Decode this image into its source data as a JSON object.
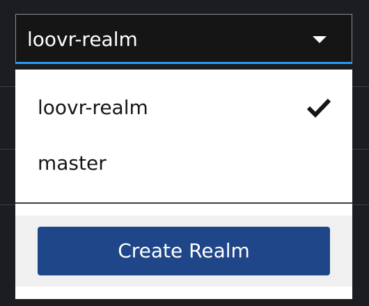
{
  "toggle": {
    "selected_label": "loovr-realm",
    "icon": "caret-down-icon"
  },
  "menu": {
    "items": [
      {
        "label": "loovr-realm",
        "selected": true,
        "icon": "check-icon"
      },
      {
        "label": "master",
        "selected": false
      }
    ],
    "create_button_label": "Create Realm"
  },
  "colors": {
    "background": "#1b1d21",
    "toggle_background": "#151515",
    "toggle_underline": "#2b9af3",
    "menu_background": "#ffffff",
    "footer_background": "#f0f0f0",
    "primary_button": "#1e4688"
  }
}
